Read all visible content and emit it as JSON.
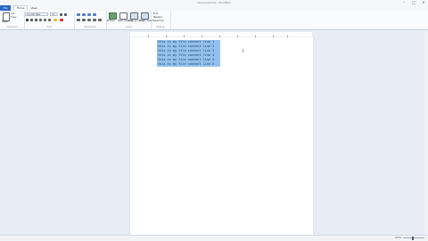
{
  "window": {
    "title": "Document.txt - WordPad",
    "controls": {
      "minimize": "–",
      "maximize": "□",
      "close": "×"
    }
  },
  "tabs": {
    "file": "File",
    "home": "Home",
    "view": "View"
  },
  "ribbon": {
    "clipboard": {
      "label": "Clipboard",
      "paste": "Paste",
      "cut": "Cut",
      "copy": "Copy"
    },
    "font": {
      "label": "Font",
      "family": "Courier New",
      "size": "11"
    },
    "paragraph": {
      "label": "Paragraph"
    },
    "insert": {
      "label": "Insert",
      "picture": "Picture",
      "paint": "Paint drawing",
      "datetime": "Date and time",
      "object": "Insert object"
    },
    "editing": {
      "label": "Editing",
      "find": "Find",
      "replace": "Replace",
      "select_all": "Select all"
    }
  },
  "document": {
    "lines": [
      "this is my file content line 1",
      "this is my file content line 2",
      "this is my file content line 3",
      "this is my file content line 4",
      "this is my file content line 5",
      "this is my file content line 6"
    ]
  },
  "status": {
    "zoom": "100%"
  }
}
